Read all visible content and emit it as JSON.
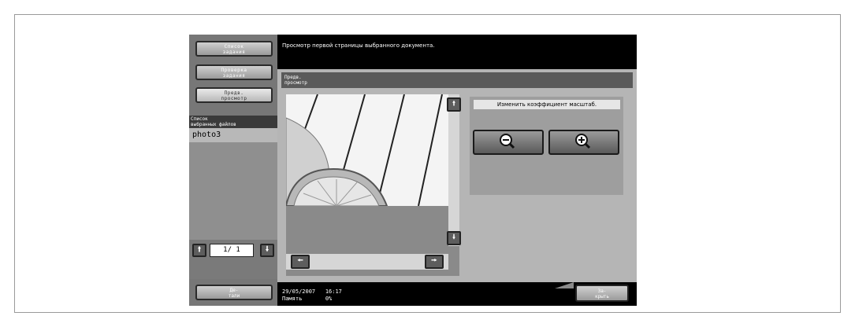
{
  "left_panel": {
    "buttons": [
      {
        "label_line1": "Список",
        "label_line2": "задания"
      },
      {
        "label_line1": "Проверка",
        "label_line2": "задания"
      },
      {
        "label_line1": "Предв.",
        "label_line2": "просмотр"
      }
    ],
    "file_list_header_line1": "Список",
    "file_list_header_line2": "выбранных файлов",
    "files": [
      "photo3"
    ],
    "pager": {
      "current": "1",
      "separator": "/",
      "total": "1",
      "display": "1/ 1"
    },
    "detail_button_line1": "Де-",
    "detail_button_line2": "тали"
  },
  "message": "Просмотр первой страницы выбранного документа.",
  "main": {
    "header_line1": "Предв.",
    "header_line2": "просмотр",
    "zoom_label": "Изменить коэффициент масштаб."
  },
  "footer": {
    "date": "29/05/2007",
    "time": "16:17",
    "memory_label": "Память",
    "memory_value": "0%",
    "close_line1": "За-",
    "close_line2": "крыть"
  },
  "icons": {
    "up": "arrow-up-icon",
    "down": "arrow-down-icon",
    "left": "arrow-left-icon",
    "right": "arrow-right-icon",
    "zoom_out": "zoom-out-icon",
    "zoom_in": "zoom-in-icon"
  }
}
